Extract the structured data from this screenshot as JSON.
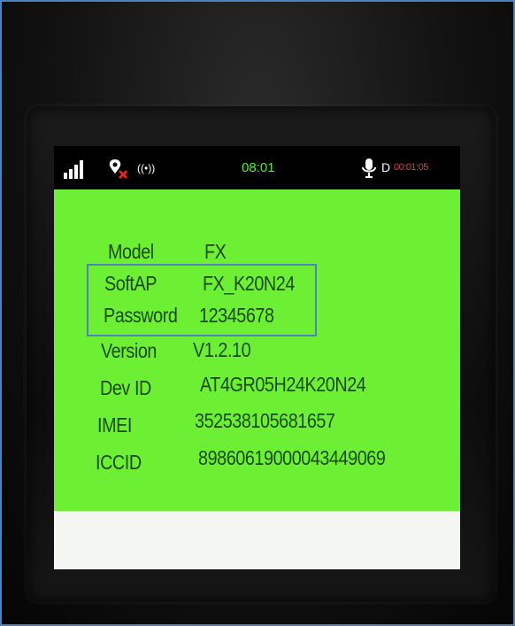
{
  "status_bar": {
    "time": "08:01",
    "mode_letter": "D",
    "timer": "00:01:05",
    "wireless_glyph": "((•))",
    "icons": [
      "signal-bars-icon",
      "location-off-icon",
      "wireless-broadcast-icon",
      "microphone-icon"
    ],
    "colors": {
      "time": "#4cf01a",
      "timer": "#ff3030"
    }
  },
  "device_info": {
    "rows": [
      {
        "label": "Model",
        "value": "FX"
      },
      {
        "label": "SoftAP",
        "value": "FX_K20N24"
      },
      {
        "label": "Password",
        "value": "12345678"
      },
      {
        "label": "Version",
        "value": "V1.2.10"
      },
      {
        "label": "Dev ID",
        "value": "AT4GR05H24K20N24"
      },
      {
        "label": "IMEI",
        "value": "352538105681657"
      },
      {
        "label": "ICCID",
        "value": "89860619000043449069"
      }
    ]
  },
  "colors": {
    "screen_background": "#6df033",
    "text": "#1a4a0a",
    "highlight_border": "#4f81bd"
  }
}
